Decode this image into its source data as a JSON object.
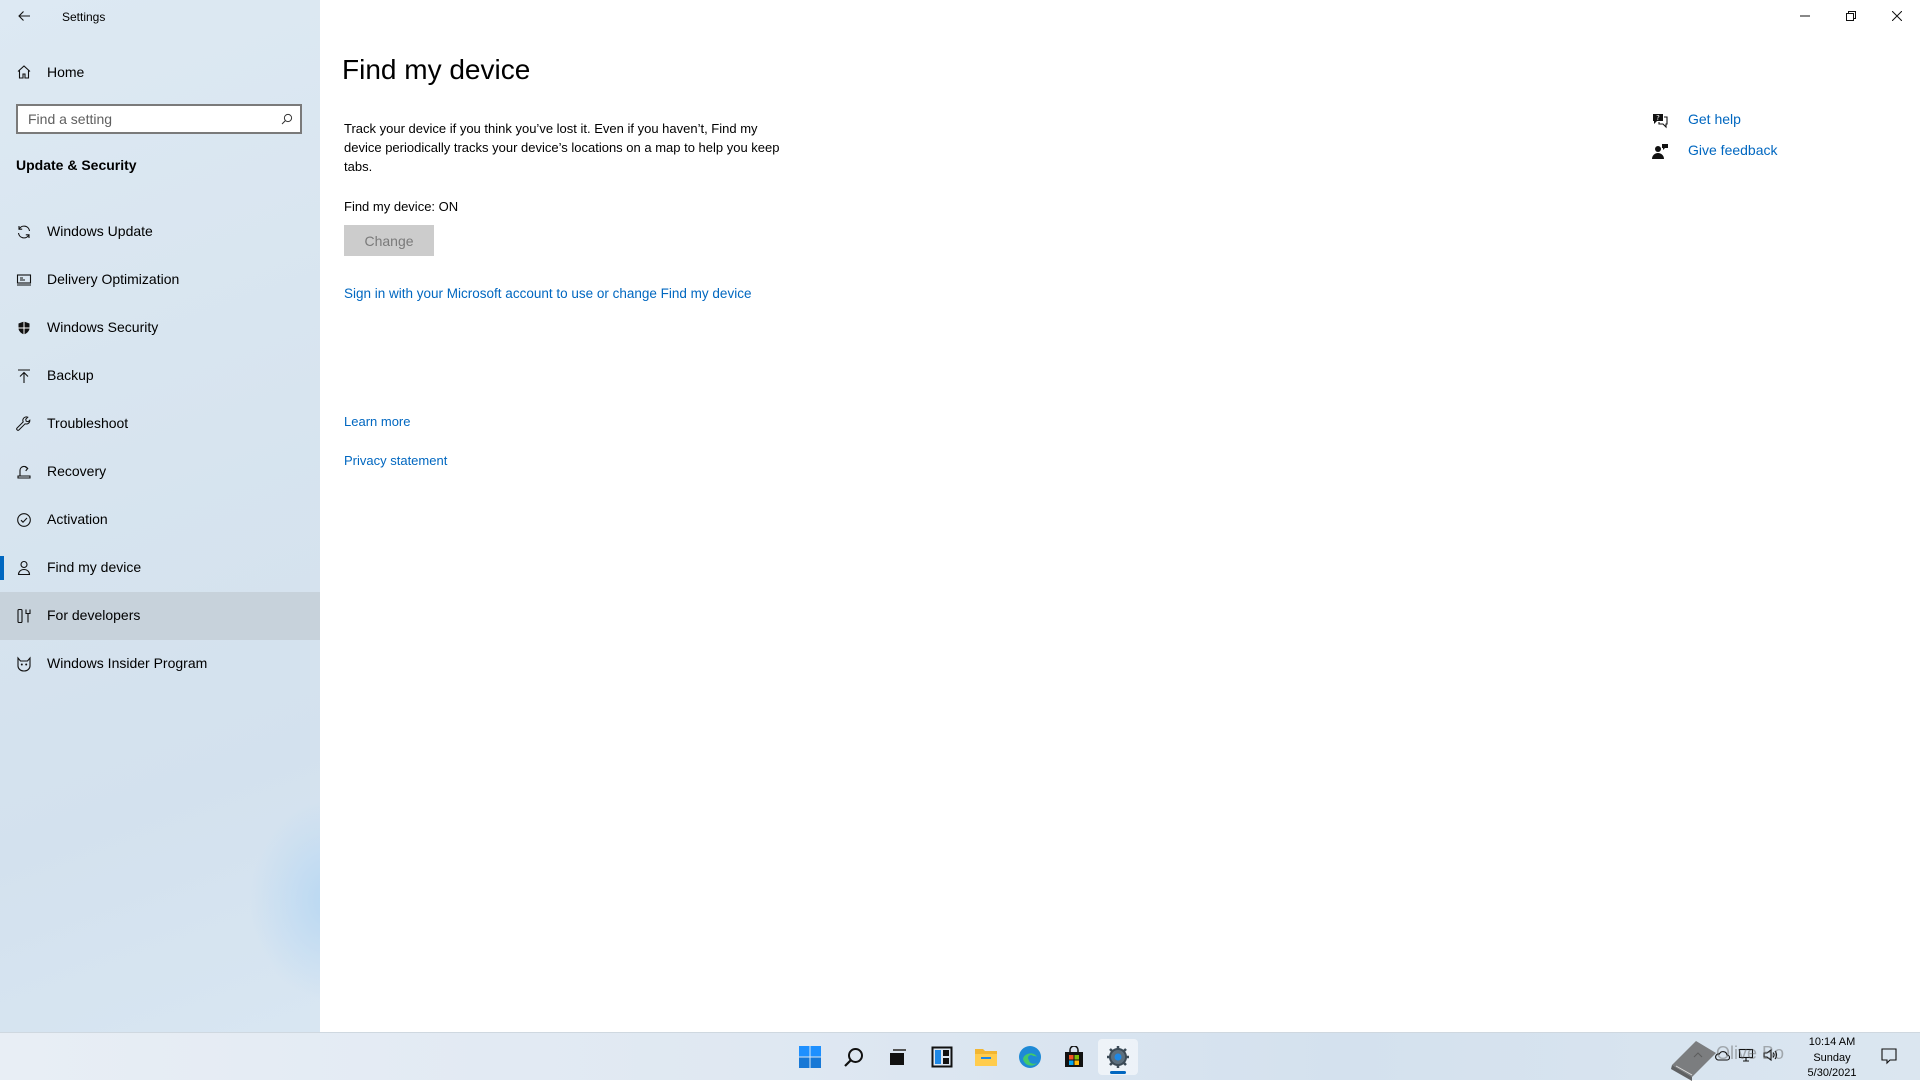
{
  "window": {
    "title": "Settings",
    "controls": {
      "minimize": "minimize-icon",
      "restore": "restore-icon",
      "close": "close-icon"
    }
  },
  "sidebar": {
    "home_label": "Home",
    "search": {
      "placeholder": "Find a setting",
      "value": ""
    },
    "section_title": "Update & Security",
    "items": [
      {
        "label": "Windows Update",
        "icon": "sync-icon"
      },
      {
        "label": "Delivery Optimization",
        "icon": "delivery-optimization-icon"
      },
      {
        "label": "Windows Security",
        "icon": "shield-icon"
      },
      {
        "label": "Backup",
        "icon": "backup-icon"
      },
      {
        "label": "Troubleshoot",
        "icon": "wrench-icon"
      },
      {
        "label": "Recovery",
        "icon": "recovery-icon"
      },
      {
        "label": "Activation",
        "icon": "check-circle-icon"
      },
      {
        "label": "Find my device",
        "icon": "person-location-icon",
        "selected": true
      },
      {
        "label": "For developers",
        "icon": "developer-tools-icon",
        "hover": true
      },
      {
        "label": "Windows Insider Program",
        "icon": "insider-cat-icon"
      }
    ]
  },
  "main": {
    "title": "Find my device",
    "description": "Track your device if you think you’ve lost it. Even if you haven’t, Find my device periodically tracks your device’s locations on a map to help you keep tabs.",
    "status": "Find my device: ON",
    "change_label": "Change",
    "signin_link": "Sign in with your Microsoft account to use or change Find my device",
    "learn_more": "Learn more",
    "privacy_statement": "Privacy statement",
    "help": {
      "get_help": "Get help",
      "give_feedback": "Give feedback"
    }
  },
  "taskbar": {
    "apps": [
      "start-icon",
      "search-icon",
      "task-view-icon",
      "widgets-icon",
      "file-explorer-icon",
      "edge-icon",
      "store-icon",
      "settings-icon"
    ],
    "active_app": "settings-icon",
    "clock": {
      "time": "10:14 AM",
      "day": "Sunday",
      "date": "5/30/2021"
    },
    "watermark": "Olive Bo"
  },
  "colors": {
    "accent": "#0067c0",
    "sidebar_bg": "#d7e4ef",
    "hover_bg": "#c7d2db",
    "button_disabled_bg": "#cccccc"
  }
}
